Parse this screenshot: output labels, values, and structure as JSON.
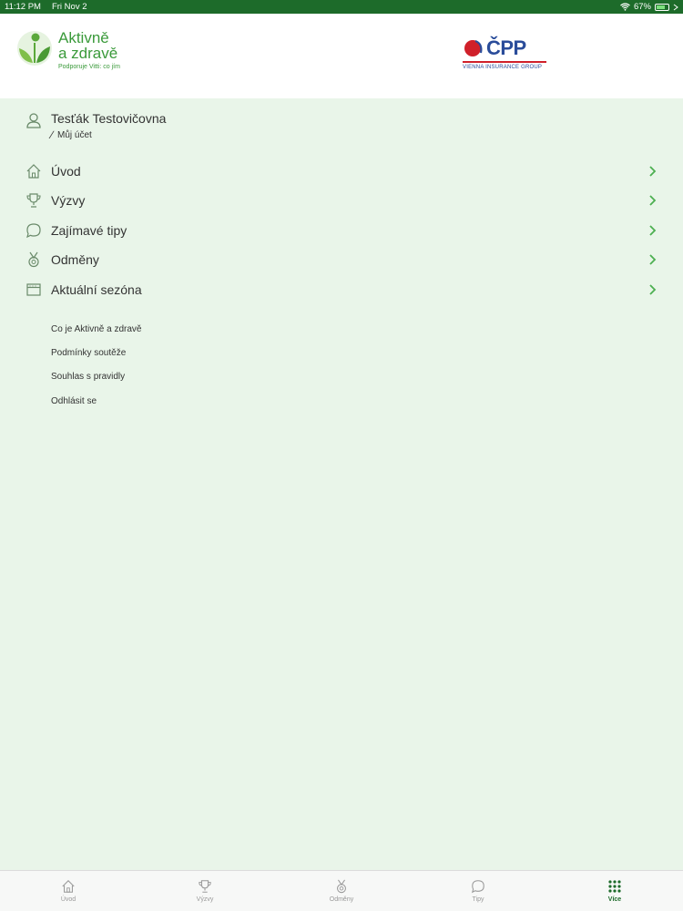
{
  "status_bar": {
    "time": "11:12 PM",
    "date": "Fri Nov 2",
    "battery": "67%",
    "battery_level": 0.67
  },
  "header": {
    "brand_line1": "Aktivně",
    "brand_line2": "a zdravě",
    "brand_tagline": "Podporuje Vitti: co jím",
    "partner_name": "ČPP",
    "partner_sub": "VIENNA INSURANCE GROUP"
  },
  "profile": {
    "name": "Tesťák Testovičovna",
    "account_label": "Můj účet"
  },
  "menu": {
    "items": [
      {
        "label": "Úvod",
        "icon": "home-icon"
      },
      {
        "label": "Výzvy",
        "icon": "trophy-icon"
      },
      {
        "label": "Zajímavé tipy",
        "icon": "chat-bubble-icon"
      },
      {
        "label": "Odměny",
        "icon": "medal-icon"
      },
      {
        "label": "Aktuální sezóna",
        "icon": "calendar-icon"
      }
    ]
  },
  "links": [
    "Co je Aktivně a zdravě",
    "Podmínky soutěže",
    "Souhlas s pravidly",
    "Odhlásit se"
  ],
  "tabbar": {
    "tabs": [
      {
        "label": "Úvod",
        "icon": "home-icon"
      },
      {
        "label": "Výzvy",
        "icon": "trophy-icon"
      },
      {
        "label": "Odměny",
        "icon": "medal-icon"
      },
      {
        "label": "Tipy",
        "icon": "chat-bubble-icon"
      },
      {
        "label": "Více",
        "icon": "grid-icon",
        "active": true
      }
    ]
  },
  "colors": {
    "accent": "#4caf50",
    "header_green": "#1d6b2a",
    "background": "#e9f5e9"
  }
}
